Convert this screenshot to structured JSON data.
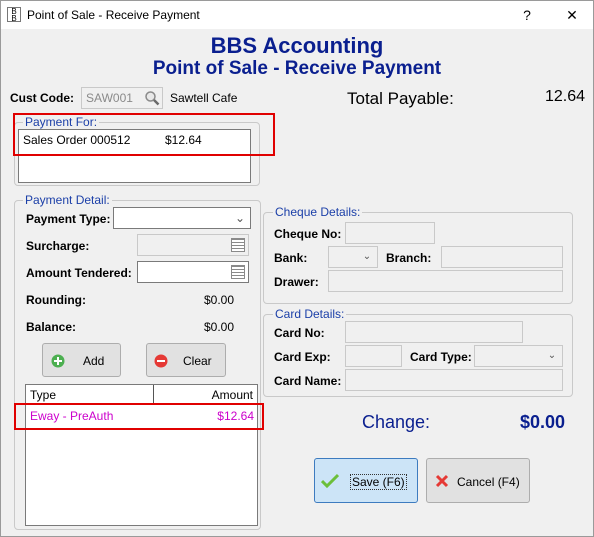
{
  "window": {
    "title": "Point of Sale - Receive Payment",
    "help_label": "?",
    "close_label": "✕"
  },
  "header": {
    "company": "BBS Accounting",
    "subtitle": "Point of Sale - Receive Payment"
  },
  "customer": {
    "label": "Cust Code:",
    "code": "SAW001",
    "name": "Sawtell Cafe"
  },
  "total": {
    "label": "Total Payable:",
    "value": "12.64"
  },
  "payment_for": {
    "title": "Payment For:",
    "item": "Sales Order 000512",
    "amount": "$12.64"
  },
  "payment_detail": {
    "title": "Payment Detail:",
    "type_label": "Payment Type:",
    "type_value": "",
    "surcharge_label": "Surcharge:",
    "amount_label": "Amount Tendered:",
    "rounding_label": "Rounding:",
    "rounding_value": "$0.00",
    "balance_label": "Balance:",
    "balance_value": "$0.00",
    "add_label": "Add",
    "clear_label": "Clear",
    "table": {
      "col_type": "Type",
      "col_amount": "Amount",
      "rows": [
        {
          "type": "Eway - PreAuth",
          "amount": "$12.64"
        }
      ]
    }
  },
  "cheque": {
    "title": "Cheque Details:",
    "no_label": "Cheque No:",
    "bank_label": "Bank:",
    "branch_label": "Branch:",
    "drawer_label": "Drawer:"
  },
  "card": {
    "title": "Card Details:",
    "no_label": "Card No:",
    "exp_label": "Card Exp:",
    "type_label": "Card Type:",
    "name_label": "Card Name:"
  },
  "change": {
    "label": "Change:",
    "value": "$0.00"
  },
  "buttons": {
    "save_label": "Save (F6)",
    "cancel_label": "Cancel (F4)"
  },
  "colors": {
    "heading": "#0a1f8f",
    "group_title": "#1b3fa8",
    "row_text": "#cc00cc",
    "highlight_box": "#e00000"
  },
  "icons": {
    "app": "bbs-app-icon",
    "search": "search-icon",
    "calendar": "calendar-icon",
    "add": "add-icon",
    "clear": "clear-icon",
    "save": "checkmark-icon",
    "cancel": "x-icon"
  }
}
